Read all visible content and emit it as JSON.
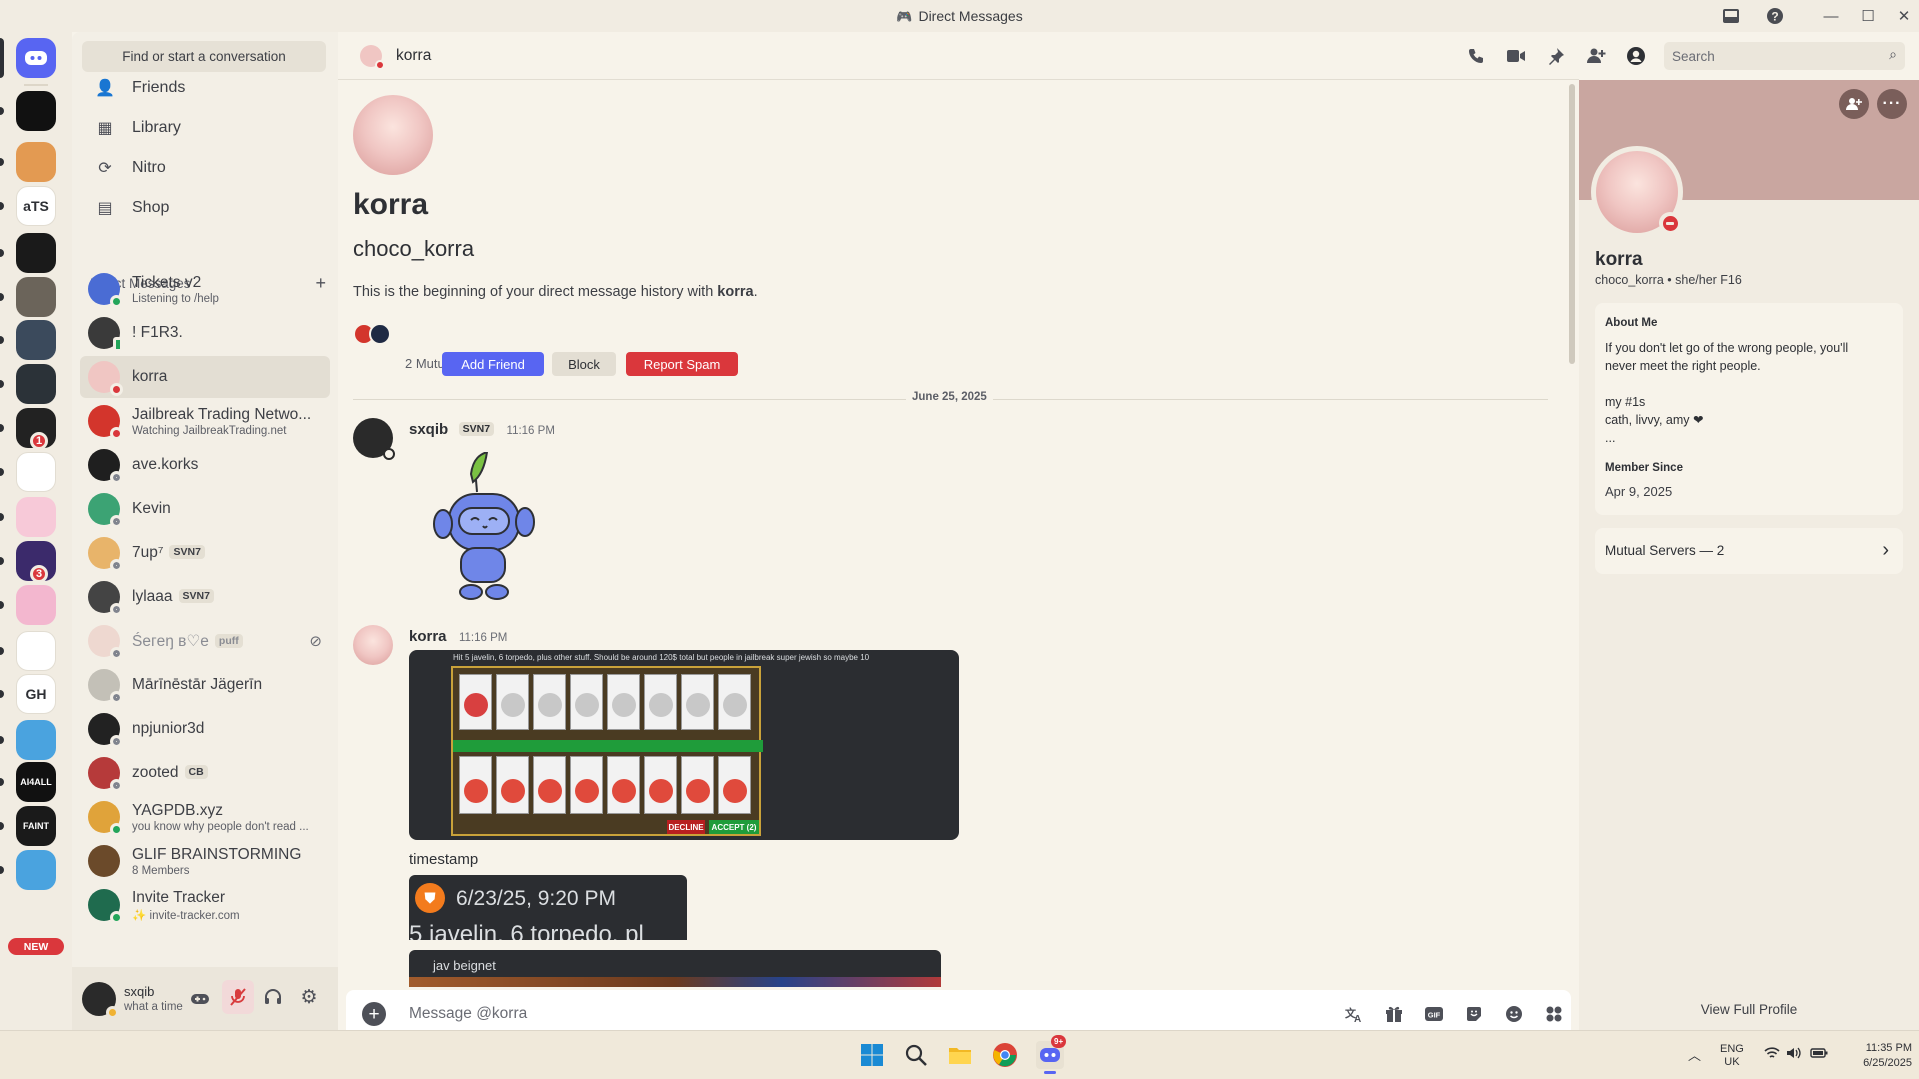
{
  "window": {
    "title": "Direct Messages"
  },
  "rail": {
    "servers": [
      {
        "label": "",
        "color": "#5865f2"
      },
      {
        "label": "",
        "color": "#111111"
      },
      {
        "label": "",
        "color": "#e39a52"
      },
      {
        "label": "aTS",
        "color": "#ffffff"
      },
      {
        "label": "",
        "color": "#1a1a1a"
      },
      {
        "label": "",
        "color": "#6b645a"
      },
      {
        "label": "",
        "color": "#3b4a5c"
      },
      {
        "label": "",
        "color": "#2b3238"
      },
      {
        "label": "",
        "color": "#222222",
        "badge": "1"
      },
      {
        "label": "",
        "color": "#ffffff"
      },
      {
        "label": "",
        "color": "#f7c9d8"
      },
      {
        "label": "",
        "color": "#3b2a6b",
        "badge": "3"
      },
      {
        "label": "",
        "color": "#f3b7cf"
      },
      {
        "label": "",
        "color": "#ffffff"
      },
      {
        "label": "GH",
        "color": "#ffffff"
      },
      {
        "label": "",
        "color": "#4aa3df"
      },
      {
        "label": "AI4ALL",
        "color": "#111111"
      },
      {
        "label": "FAINT",
        "color": "#1a1a1a"
      },
      {
        "label": "",
        "color": "#4aa3df"
      }
    ],
    "new_label": "NEW"
  },
  "sidebar": {
    "find_placeholder": "Find or start a conversation",
    "nav": [
      {
        "label": "Friends",
        "icon": "friends-icon"
      },
      {
        "label": "Library",
        "icon": "library-icon"
      },
      {
        "label": "Nitro",
        "icon": "nitro-icon"
      },
      {
        "label": "Shop",
        "icon": "shop-icon"
      }
    ],
    "dm_header": "Direct Messages",
    "dms": [
      {
        "name": "Tickets v2",
        "sub": "Listening to /help",
        "status": "online",
        "color": "#4a6cd4"
      },
      {
        "name": "! F1R3.",
        "sub": "",
        "status": "mobile",
        "color": "#3a3a3a"
      },
      {
        "name": "korra",
        "sub": "",
        "status": "dnd",
        "color": "#f0c6c3",
        "selected": true
      },
      {
        "name": "Jailbreak Trading Netwo...",
        "sub": "Watching JailbreakTrading.net",
        "status": "dnd",
        "color": "#d3352c"
      },
      {
        "name": "ave.korks",
        "sub": "",
        "status": "offline",
        "color": "#1f1f1f"
      },
      {
        "name": "Kevin",
        "sub": "",
        "status": "offline",
        "color": "#3ca374"
      },
      {
        "name": "7up⁷",
        "tag": "SVN7",
        "sub": "",
        "status": "offline",
        "color": "#e8b46a"
      },
      {
        "name": "lylaaa",
        "tag": "SVN7",
        "sub": "",
        "status": "offline",
        "color": "#444444"
      },
      {
        "name": "Śeгeŋ в♡e",
        "tag": "puff",
        "sub": "",
        "status": "offline",
        "color": "#eed8d0",
        "muted": true
      },
      {
        "name": "Mārīnēstār Jägerīn",
        "sub": "",
        "status": "offline",
        "color": "#c3c0b7"
      },
      {
        "name": "npjunior3d",
        "sub": "",
        "status": "offline",
        "color": "#222222"
      },
      {
        "name": "zooted",
        "tag": "CB",
        "sub": "",
        "status": "offline",
        "color": "#b63a3a"
      },
      {
        "name": "YAGPDB.xyz",
        "sub": "you know why people don't read ...",
        "status": "online",
        "color": "#e0a33a"
      },
      {
        "name": "GLIF BRAINSTORMING",
        "sub": "8 Members",
        "status": "",
        "color": "#6b4a2a"
      },
      {
        "name": "Invite Tracker",
        "sub": "✨ invite-tracker.com",
        "status": "online",
        "color": "#1f6b4e"
      }
    ],
    "user": {
      "name": "sxqib",
      "status_text": "what a time"
    }
  },
  "header": {
    "name": "korra",
    "search_placeholder": "Search"
  },
  "chat": {
    "title": "korra",
    "username": "choco_korra",
    "intro_prefix": "This is the beginning of your direct message history with ",
    "intro_name": "korra",
    "intro_suffix": ".",
    "mutual_servers": "2 Mutual Servers",
    "add_friend": "Add Friend",
    "block": "Block",
    "report_spam": "Report Spam",
    "date_divider": "June 25, 2025",
    "messages": [
      {
        "author": "sxqib",
        "tag": "SVN7",
        "time": "11:16 PM"
      },
      {
        "author": "korra",
        "time": "11:16 PM",
        "image_caption": "Hit 5 javelin, 6 torpedo, plus other stuff. Should be around 120$ total but people in jailbreak super jewish so maybe 10",
        "trade_decline": "DECLINE",
        "trade_accept": "ACCEPT (2)",
        "text": "timestamp",
        "ts_embed": "6/23/25, 9:20 PM",
        "ts_embed_sub": "5 javelin, 6 torpedo, pl",
        "reply_name": "jav beignet"
      }
    ],
    "composer_placeholder": "Message @korra"
  },
  "profile": {
    "display_name": "korra",
    "username": "choco_korra",
    "pronouns": "she/her F16",
    "about_heading": "About Me",
    "about_lines": [
      "If you don't let go of the wrong people, you'll",
      "never meet the right people.",
      "",
      "my #1s",
      "cath, livvy, amy ❤",
      "..."
    ],
    "member_since_heading": "Member Since",
    "member_since": "Apr 9, 2025",
    "mutual_servers": "Mutual Servers — 2",
    "view_full_profile": "View Full Profile",
    "banner_color": "#c9a6a0"
  },
  "taskbar": {
    "lang": "ENG",
    "region": "UK",
    "time": "11:35 PM",
    "date": "6/25/2025",
    "discord_badge": "9+"
  }
}
